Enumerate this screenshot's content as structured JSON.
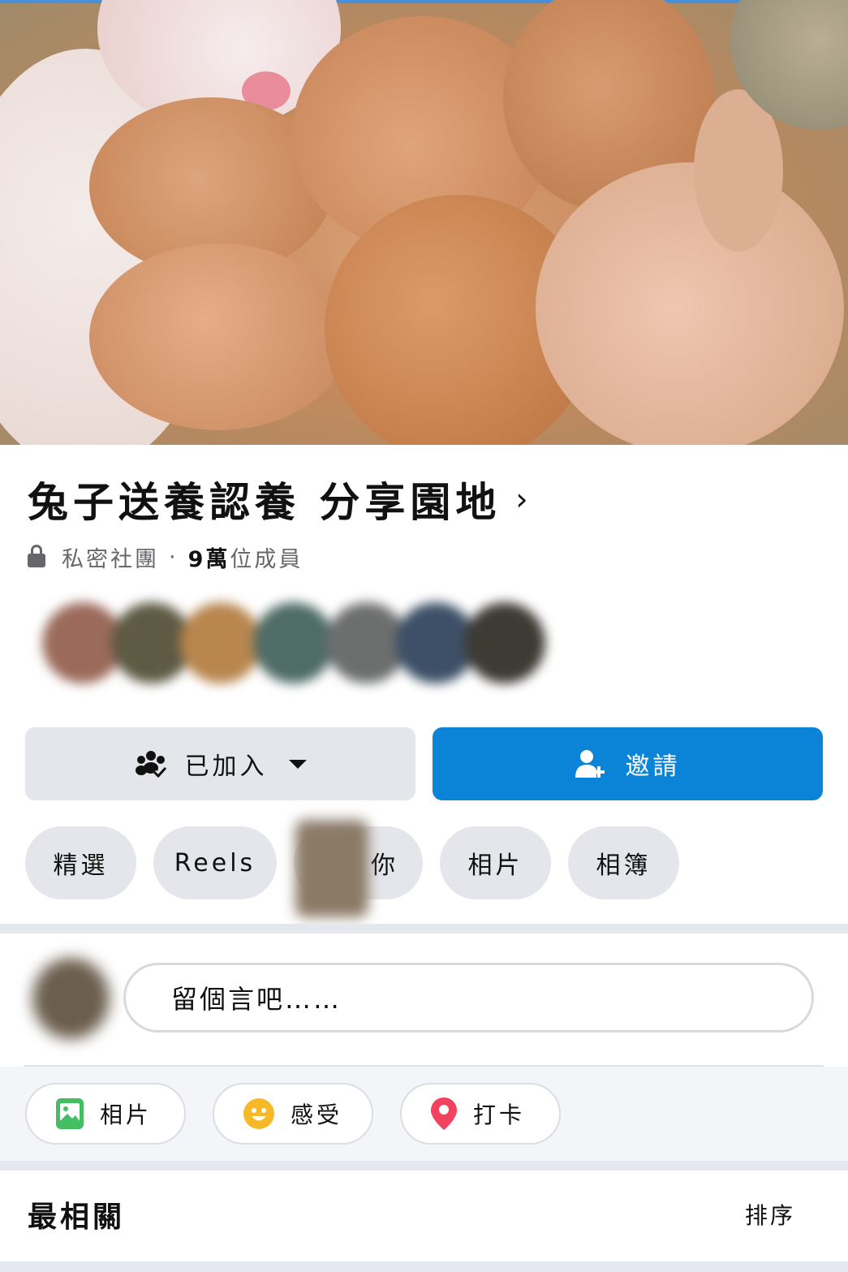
{
  "group": {
    "name": "兔子送養認養 分享園地",
    "privacy": "私密社團",
    "separator": "·",
    "member_count": "9萬",
    "member_suffix": "位成員"
  },
  "actions": {
    "joined_label": "已加入",
    "invite_label": "邀請"
  },
  "tabs": [
    {
      "label": "精選"
    },
    {
      "label": "Reels"
    },
    {
      "label": "你"
    },
    {
      "label": "相片"
    },
    {
      "label": "相簿"
    }
  ],
  "composer": {
    "placeholder": "留個言吧……"
  },
  "post_options": [
    {
      "label": "相片",
      "icon": "photo-icon"
    },
    {
      "label": "感受",
      "icon": "smiley-icon"
    },
    {
      "label": "打卡",
      "icon": "location-pin-icon"
    }
  ],
  "feed": {
    "section_title": "最相關",
    "sort_label": "排序"
  },
  "colors": {
    "invite_button": "#0b84d8",
    "secondary_button": "#e4e6eb",
    "photo_icon": "#45bd62",
    "smiley_icon": "#f7b928",
    "pin_icon": "#f3425f"
  }
}
